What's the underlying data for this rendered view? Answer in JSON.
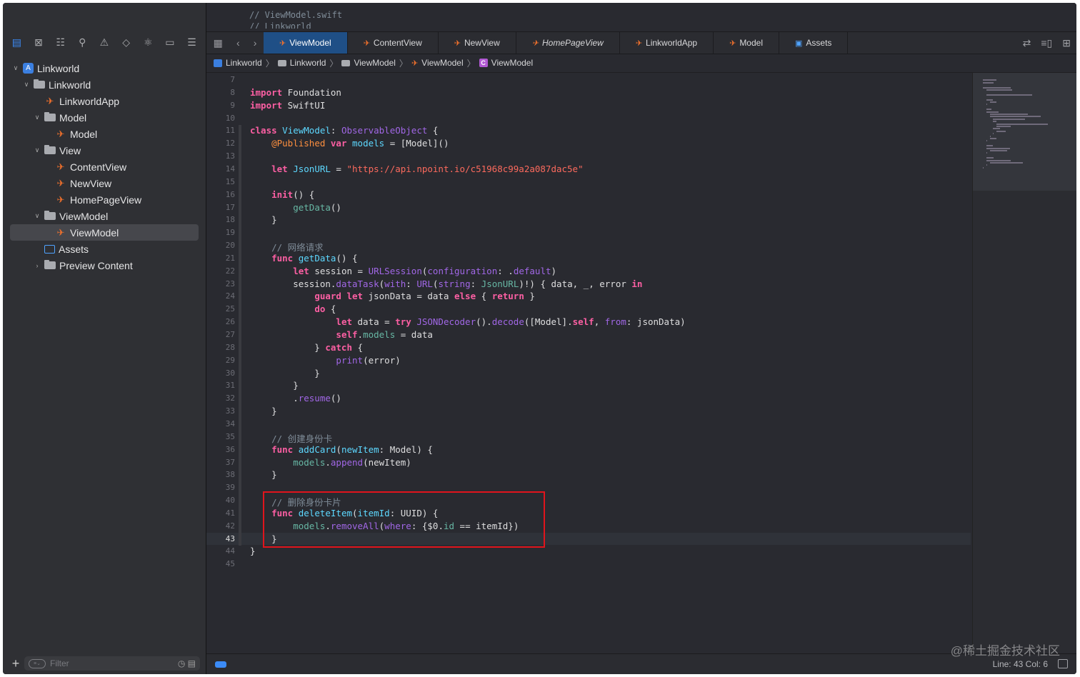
{
  "prev_header": {
    "line1": "//  ViewModel.swift",
    "line2": "//  Linkworld"
  },
  "sidebar": {
    "items": [
      {
        "label": "Linkworld",
        "indent": 0,
        "chevron": "open",
        "icon": "project-icon"
      },
      {
        "label": "Linkworld",
        "indent": 1,
        "chevron": "open",
        "icon": "folder-icon"
      },
      {
        "label": "LinkworldApp",
        "indent": 2,
        "chevron": "",
        "icon": "swift-file-icon"
      },
      {
        "label": "Model",
        "indent": 2,
        "chevron": "open",
        "icon": "folder-icon"
      },
      {
        "label": "Model",
        "indent": 3,
        "chevron": "",
        "icon": "swift-file-icon"
      },
      {
        "label": "View",
        "indent": 2,
        "chevron": "open",
        "icon": "folder-icon"
      },
      {
        "label": "ContentView",
        "indent": 3,
        "chevron": "",
        "icon": "swift-file-icon"
      },
      {
        "label": "NewView",
        "indent": 3,
        "chevron": "",
        "icon": "swift-file-icon"
      },
      {
        "label": "HomePageView",
        "indent": 3,
        "chevron": "",
        "icon": "swift-file-icon"
      },
      {
        "label": "ViewModel",
        "indent": 2,
        "chevron": "open",
        "icon": "folder-icon"
      },
      {
        "label": "ViewModel",
        "indent": 3,
        "chevron": "",
        "icon": "swift-file-icon",
        "selected": true
      },
      {
        "label": "Assets",
        "indent": 2,
        "chevron": "",
        "icon": "assets-icon"
      },
      {
        "label": "Preview Content",
        "indent": 2,
        "chevron": "closed",
        "icon": "folder-icon"
      }
    ],
    "filter_placeholder": "Filter"
  },
  "tabs": [
    {
      "label": "ViewModel",
      "active": true
    },
    {
      "label": "ContentView"
    },
    {
      "label": "NewView"
    },
    {
      "label": "HomePageView",
      "italic": true
    },
    {
      "label": "LinkworldApp"
    },
    {
      "label": "Model"
    },
    {
      "label": "Assets",
      "icon": "assets-icon"
    }
  ],
  "breadcrumbs": [
    "Linkworld",
    "Linkworld",
    "ViewModel",
    "ViewModel",
    "ViewModel"
  ],
  "code": {
    "current_line": 43,
    "lines": [
      {
        "n": 7,
        "t": []
      },
      {
        "n": 8,
        "t": [
          [
            "kw",
            "import"
          ],
          [
            "pl",
            " Foundation"
          ]
        ]
      },
      {
        "n": 9,
        "t": [
          [
            "kw",
            "import"
          ],
          [
            "pl",
            " SwiftUI"
          ]
        ]
      },
      {
        "n": 10,
        "t": []
      },
      {
        "n": 11,
        "t": [
          [
            "kw",
            "class"
          ],
          [
            "pl",
            " "
          ],
          [
            "typ",
            "ViewModel"
          ],
          [
            "pl",
            ": "
          ],
          [
            "ty",
            "ObservableObject"
          ],
          [
            "pl",
            " {"
          ]
        ]
      },
      {
        "n": 12,
        "t": [
          [
            "pl",
            "    "
          ],
          [
            "at",
            "@Published"
          ],
          [
            "pl",
            " "
          ],
          [
            "kw",
            "var"
          ],
          [
            "pl",
            " "
          ],
          [
            "typ",
            "models"
          ],
          [
            "pl",
            " = [Model]()"
          ]
        ]
      },
      {
        "n": 13,
        "t": []
      },
      {
        "n": 14,
        "t": [
          [
            "pl",
            "    "
          ],
          [
            "kw",
            "let"
          ],
          [
            "pl",
            " "
          ],
          [
            "typ",
            "JsonURL"
          ],
          [
            "pl",
            " = "
          ],
          [
            "str",
            "\"https://api.npoint.io/c51968c99a2a087dac5e\""
          ]
        ]
      },
      {
        "n": 15,
        "t": []
      },
      {
        "n": 16,
        "t": [
          [
            "pl",
            "    "
          ],
          [
            "kw",
            "init"
          ],
          [
            "pl",
            "() {"
          ]
        ]
      },
      {
        "n": 17,
        "t": [
          [
            "pl",
            "        "
          ],
          [
            "fn",
            "getData"
          ],
          [
            "pl",
            "()"
          ]
        ]
      },
      {
        "n": 18,
        "t": [
          [
            "pl",
            "    }"
          ]
        ]
      },
      {
        "n": 19,
        "t": []
      },
      {
        "n": 20,
        "t": [
          [
            "cm",
            "    // 网络请求"
          ]
        ]
      },
      {
        "n": 21,
        "t": [
          [
            "pl",
            "    "
          ],
          [
            "kw",
            "func"
          ],
          [
            "pl",
            " "
          ],
          [
            "typ",
            "getData"
          ],
          [
            "pl",
            "() {"
          ]
        ]
      },
      {
        "n": 22,
        "t": [
          [
            "pl",
            "        "
          ],
          [
            "kw",
            "let"
          ],
          [
            "pl",
            " session = "
          ],
          [
            "ty",
            "URLSession"
          ],
          [
            "pl",
            "("
          ],
          [
            "ty",
            "configuration"
          ],
          [
            "pl",
            ": ."
          ],
          [
            "ty",
            "default"
          ],
          [
            "pl",
            ")"
          ]
        ]
      },
      {
        "n": 23,
        "t": [
          [
            "pl",
            "        session."
          ],
          [
            "ty",
            "dataTask"
          ],
          [
            "pl",
            "("
          ],
          [
            "ty",
            "with"
          ],
          [
            "pl",
            ": "
          ],
          [
            "ty",
            "URL"
          ],
          [
            "pl",
            "("
          ],
          [
            "ty",
            "string"
          ],
          [
            "pl",
            ": "
          ],
          [
            "fn",
            "JsonURL"
          ],
          [
            "pl",
            ")!) { data, _, error "
          ],
          [
            "kw",
            "in"
          ]
        ]
      },
      {
        "n": 24,
        "t": [
          [
            "pl",
            "            "
          ],
          [
            "kw",
            "guard"
          ],
          [
            "pl",
            " "
          ],
          [
            "kw",
            "let"
          ],
          [
            "pl",
            " jsonData = data "
          ],
          [
            "kw",
            "else"
          ],
          [
            "pl",
            " { "
          ],
          [
            "kw",
            "return"
          ],
          [
            "pl",
            " }"
          ]
        ]
      },
      {
        "n": 25,
        "t": [
          [
            "pl",
            "            "
          ],
          [
            "kw",
            "do"
          ],
          [
            "pl",
            " {"
          ]
        ]
      },
      {
        "n": 26,
        "t": [
          [
            "pl",
            "                "
          ],
          [
            "kw",
            "let"
          ],
          [
            "pl",
            " data = "
          ],
          [
            "kw",
            "try"
          ],
          [
            "pl",
            " "
          ],
          [
            "ty",
            "JSONDecoder"
          ],
          [
            "pl",
            "()."
          ],
          [
            "ty",
            "decode"
          ],
          [
            "pl",
            "([Model]."
          ],
          [
            "kw",
            "self"
          ],
          [
            "pl",
            ", "
          ],
          [
            "ty",
            "from"
          ],
          [
            "pl",
            ": jsonData)"
          ]
        ]
      },
      {
        "n": 27,
        "t": [
          [
            "pl",
            "                "
          ],
          [
            "kw",
            "self"
          ],
          [
            "pl",
            "."
          ],
          [
            "fn",
            "models"
          ],
          [
            "pl",
            " = data"
          ]
        ]
      },
      {
        "n": 28,
        "t": [
          [
            "pl",
            "            } "
          ],
          [
            "kw",
            "catch"
          ],
          [
            "pl",
            " {"
          ]
        ]
      },
      {
        "n": 29,
        "t": [
          [
            "pl",
            "                "
          ],
          [
            "ty",
            "print"
          ],
          [
            "pl",
            "(error)"
          ]
        ]
      },
      {
        "n": 30,
        "t": [
          [
            "pl",
            "            }"
          ]
        ]
      },
      {
        "n": 31,
        "t": [
          [
            "pl",
            "        }"
          ]
        ]
      },
      {
        "n": 32,
        "t": [
          [
            "pl",
            "        ."
          ],
          [
            "ty",
            "resume"
          ],
          [
            "pl",
            "()"
          ]
        ]
      },
      {
        "n": 33,
        "t": [
          [
            "pl",
            "    }"
          ]
        ]
      },
      {
        "n": 34,
        "t": []
      },
      {
        "n": 35,
        "t": [
          [
            "cm",
            "    // 创建身份卡"
          ]
        ]
      },
      {
        "n": 36,
        "t": [
          [
            "pl",
            "    "
          ],
          [
            "kw",
            "func"
          ],
          [
            "pl",
            " "
          ],
          [
            "typ",
            "addCard"
          ],
          [
            "pl",
            "("
          ],
          [
            "typ",
            "newItem"
          ],
          [
            "pl",
            ": Model) {"
          ]
        ]
      },
      {
        "n": 37,
        "t": [
          [
            "pl",
            "        "
          ],
          [
            "fn",
            "models"
          ],
          [
            "pl",
            "."
          ],
          [
            "ty",
            "append"
          ],
          [
            "pl",
            "(newItem)"
          ]
        ]
      },
      {
        "n": 38,
        "t": [
          [
            "pl",
            "    }"
          ]
        ]
      },
      {
        "n": 39,
        "t": []
      },
      {
        "n": 40,
        "t": [
          [
            "cm",
            "    // 删除身份卡片"
          ]
        ]
      },
      {
        "n": 41,
        "t": [
          [
            "pl",
            "    "
          ],
          [
            "kw",
            "func"
          ],
          [
            "pl",
            " "
          ],
          [
            "typ",
            "deleteItem"
          ],
          [
            "pl",
            "("
          ],
          [
            "typ",
            "itemId"
          ],
          [
            "pl",
            ": UUID) {"
          ]
        ]
      },
      {
        "n": 42,
        "t": [
          [
            "pl",
            "        "
          ],
          [
            "fn",
            "models"
          ],
          [
            "pl",
            "."
          ],
          [
            "ty",
            "removeAll"
          ],
          [
            "pl",
            "("
          ],
          [
            "ty",
            "where"
          ],
          [
            "pl",
            ": {$0."
          ],
          [
            "fn",
            "id"
          ],
          [
            "pl",
            " == itemId})"
          ]
        ]
      },
      {
        "n": 43,
        "t": [
          [
            "pl",
            "    }"
          ]
        ]
      },
      {
        "n": 44,
        "t": [
          [
            "pl",
            "}"
          ]
        ]
      },
      {
        "n": 45,
        "t": []
      }
    ]
  },
  "status": {
    "position": "Line: 43  Col: 6"
  },
  "watermark": "@稀土掘金技术社区",
  "colors": {
    "accent": "#3b8bf7",
    "swift": "#f2712c",
    "highlight_box": "#e0141c"
  }
}
